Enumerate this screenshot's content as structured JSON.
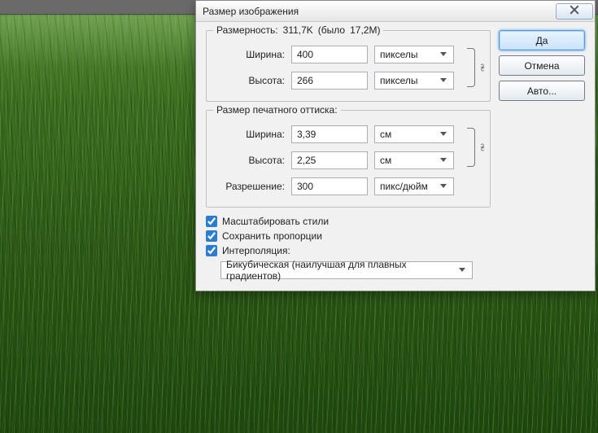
{
  "dialog": {
    "title": "Размер изображения",
    "close_icon": "close-icon",
    "groups": {
      "pixel": {
        "legend": "Размерность:",
        "file_size": "311,7K",
        "was_prefix": "(было",
        "was_value": "17,2M)",
        "width_label": "Ширина:",
        "width_value": "400",
        "width_unit": "пикселы",
        "height_label": "Высота:",
        "height_value": "266",
        "height_unit": "пикселы"
      },
      "print": {
        "legend": "Размер печатного оттиска:",
        "width_label": "Ширина:",
        "width_value": "3,39",
        "width_unit": "см",
        "height_label": "Высота:",
        "height_value": "2,25",
        "height_unit": "см",
        "res_label": "Разрешение:",
        "res_value": "300",
        "res_unit": "пикс/дюйм"
      }
    },
    "checkboxes": {
      "scale_styles": {
        "label": "Масштабировать стили",
        "checked": true
      },
      "constrain": {
        "label": "Сохранить пропорции",
        "checked": true
      },
      "interpolate": {
        "label": "Интерполяция:",
        "checked": true
      }
    },
    "interp_method": "Бикубическая (наилучшая для плавных градиентов)",
    "buttons": {
      "ok": "Да",
      "cancel": "Отмена",
      "auto": "Авто..."
    }
  }
}
